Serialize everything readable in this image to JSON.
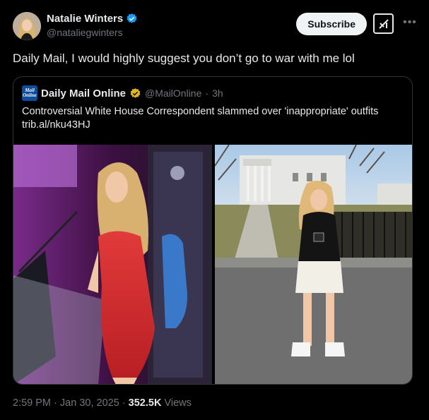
{
  "author": {
    "display_name": "Natalie Winters",
    "handle": "@nataliegwinters"
  },
  "actions": {
    "subscribe_label": "Subscribe",
    "grok_icon": "grok-icon",
    "more_icon": "more-icon"
  },
  "tweet": {
    "text": "Daily Mail, I would highly suggest you don’t go to war with me lol"
  },
  "quote": {
    "logo_text": [
      "Mail",
      "Online"
    ],
    "display_name": "Daily Mail Online",
    "handle": "@MailOnline",
    "separator": "·",
    "time": "3h",
    "text": "Controversial White House Correspondent slammed over 'inappropriate' outfits trib.al/nku43HJ"
  },
  "meta": {
    "time": "2:59 PM",
    "date": "Jan 30, 2025",
    "separator": "·",
    "views": "352.5K",
    "views_label": "Views"
  },
  "colors": {
    "background": "#000000",
    "text": "#e7e9ea",
    "muted": "#71767b",
    "verified": "#1d9bf0",
    "border": "#2f3336"
  }
}
